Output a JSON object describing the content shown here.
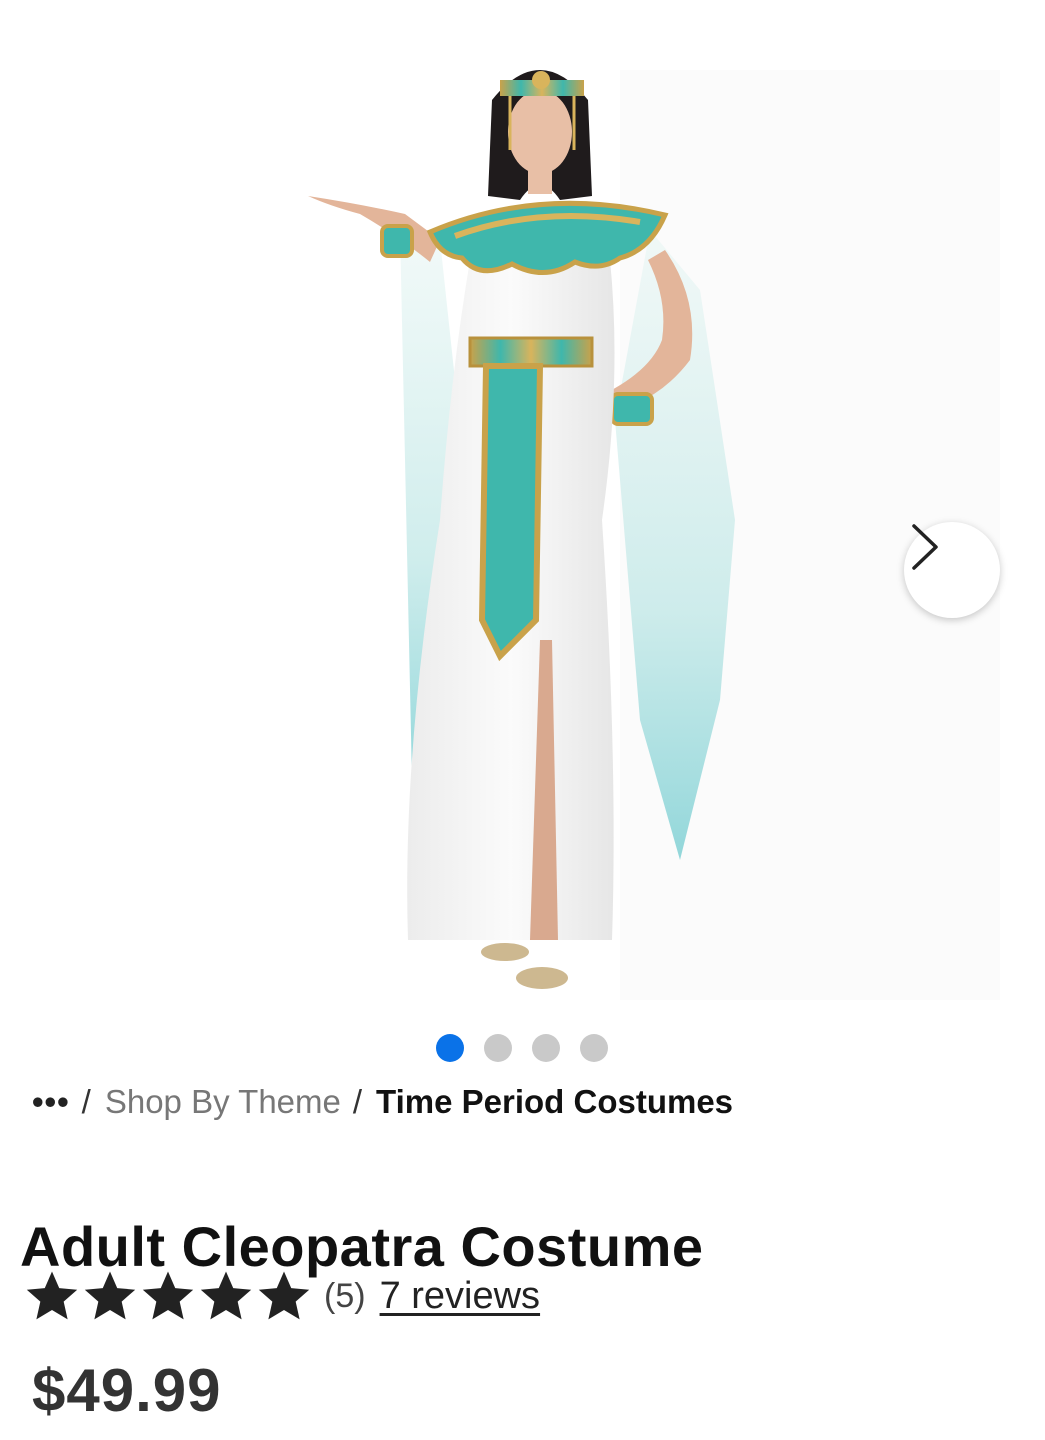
{
  "product_image": {
    "alt": "",
    "carousel": {
      "total_slides": 4,
      "active_index": 0
    },
    "next_button_icon": "chevron-right-icon"
  },
  "breadcrumb": {
    "more": "•••",
    "separator": "/",
    "items": [
      "Shop By Theme",
      "Time Period Costumes"
    ]
  },
  "product": {
    "title": "Adult Cleopatra Costume",
    "rating_value": 5,
    "rating_max": 5,
    "rating_count": "(5)",
    "reviews_link": "7 reviews",
    "price": "$49.99"
  },
  "colors": {
    "active_dot": "#0a72e8",
    "inactive_dot": "#c9c9c9",
    "star": "#222222",
    "costume_teal": "#3fb7ac",
    "costume_gold": "#c9a24a"
  }
}
